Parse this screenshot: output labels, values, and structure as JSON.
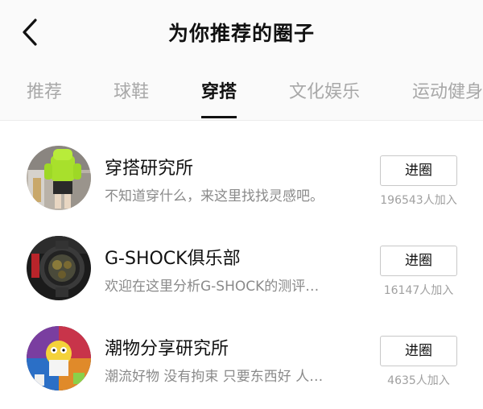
{
  "header": {
    "title": "为你推荐的圈子",
    "back_icon": "chevron-left-icon"
  },
  "tabs": [
    {
      "label": "推荐",
      "active": false
    },
    {
      "label": "球鞋",
      "active": false
    },
    {
      "label": "穿搭",
      "active": true
    },
    {
      "label": "文化娱乐",
      "active": false
    },
    {
      "label": "运动健身",
      "active": false
    }
  ],
  "circles": [
    {
      "name": "穿搭研究所",
      "desc": "不知道穿什么，来这里找找灵感吧。",
      "button_label": "进圈",
      "members": "196543人加入"
    },
    {
      "name": "G-SHOCK俱乐部",
      "desc": "欢迎在这里分析G-SHOCK的测评…",
      "button_label": "进圈",
      "members": "16147人加入"
    },
    {
      "name": "潮物分享研究所",
      "desc": "潮流好物 没有拘束 只要东西好 人…",
      "button_label": "进圈",
      "members": "4635人加入"
    }
  ],
  "colors": {
    "nav_background": "#fafafa",
    "active_tab": "#111111",
    "inactive_tab": "#a8a8a8",
    "secondary_text": "#8a8a8a"
  }
}
